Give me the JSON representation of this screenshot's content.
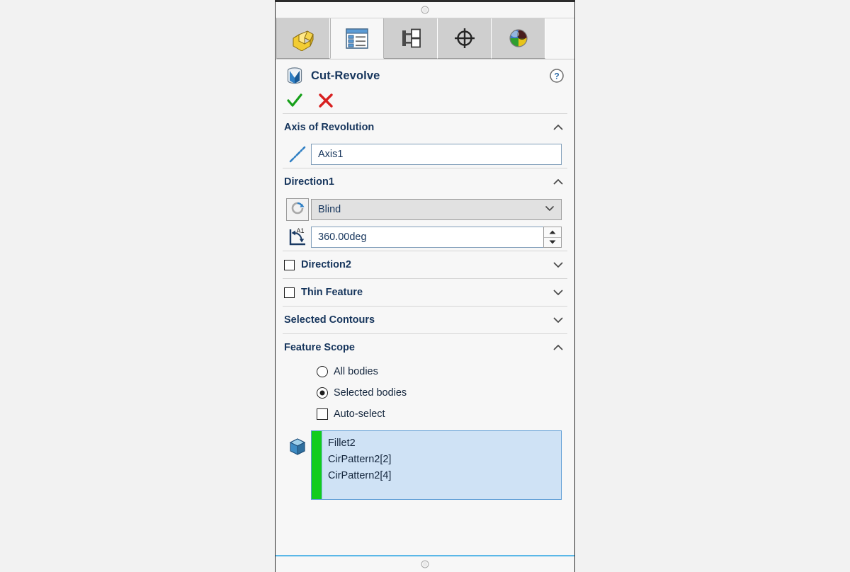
{
  "panel": {
    "tabs": [
      {
        "name": "feature-manager-design-tree",
        "icon": "yellow-blocks-icon",
        "active": false
      },
      {
        "name": "property-manager",
        "icon": "property-list-icon",
        "active": true
      },
      {
        "name": "configuration-manager",
        "icon": "tree-branch-icon",
        "active": false
      },
      {
        "name": "dimxpert-manager",
        "icon": "crosshair-target-icon",
        "active": false
      },
      {
        "name": "display-manager",
        "icon": "color-sphere-icon",
        "active": false
      }
    ],
    "header": {
      "title": "Cut-Revolve",
      "icon": "cut-revolve-icon",
      "help_icon": "question-mark-icon",
      "ok_icon": "green-checkmark-icon",
      "cancel_icon": "red-x-icon"
    },
    "sections": {
      "axis_of_revolution": {
        "title": "Axis of Revolution",
        "expanded": true,
        "chevron": "chevron-up-icon",
        "axis_icon": "dash-dot-axis-icon",
        "axis_value": "Axis1"
      },
      "direction1": {
        "title": "Direction1",
        "expanded": true,
        "chevron": "chevron-up-icon",
        "reverse_icon": "reverse-direction-icon",
        "end_condition": "Blind",
        "dropdown_icon": "chevron-down-icon",
        "angle_icon": "angle-a1-icon",
        "angle_value": "360.00deg",
        "spin_up_icon": "triangle-up-icon",
        "spin_down_icon": "triangle-down-icon"
      },
      "direction2": {
        "title": "Direction2",
        "checked": false,
        "expanded": false,
        "chevron": "chevron-down-icon"
      },
      "thin_feature": {
        "title": "Thin Feature",
        "checked": false,
        "expanded": false,
        "chevron": "chevron-down-icon"
      },
      "selected_contours": {
        "title": "Selected Contours",
        "expanded": false,
        "chevron": "chevron-down-icon"
      },
      "feature_scope": {
        "title": "Feature Scope",
        "expanded": true,
        "chevron": "chevron-up-icon",
        "options": [
          {
            "label": "All bodies",
            "type": "radio",
            "selected": false
          },
          {
            "label": "Selected bodies",
            "type": "radio",
            "selected": true
          },
          {
            "label": "Auto-select",
            "type": "checkbox",
            "selected": false
          }
        ],
        "body_icon": "solid-body-cube-icon",
        "selected_bodies": [
          "Fillet2",
          "CirPattern2[2]",
          "CirPattern2[4]"
        ]
      }
    },
    "splitter_grip_icon": "splitter-handle-icon"
  },
  "colors": {
    "title_blue": "#16355c",
    "active_green": "#12cc1e",
    "selection_blue": "#cfe2f5",
    "selection_border": "#5a9bd5",
    "panel_bg": "#f7f7f7",
    "tab_inactive": "#cfcfcf"
  }
}
